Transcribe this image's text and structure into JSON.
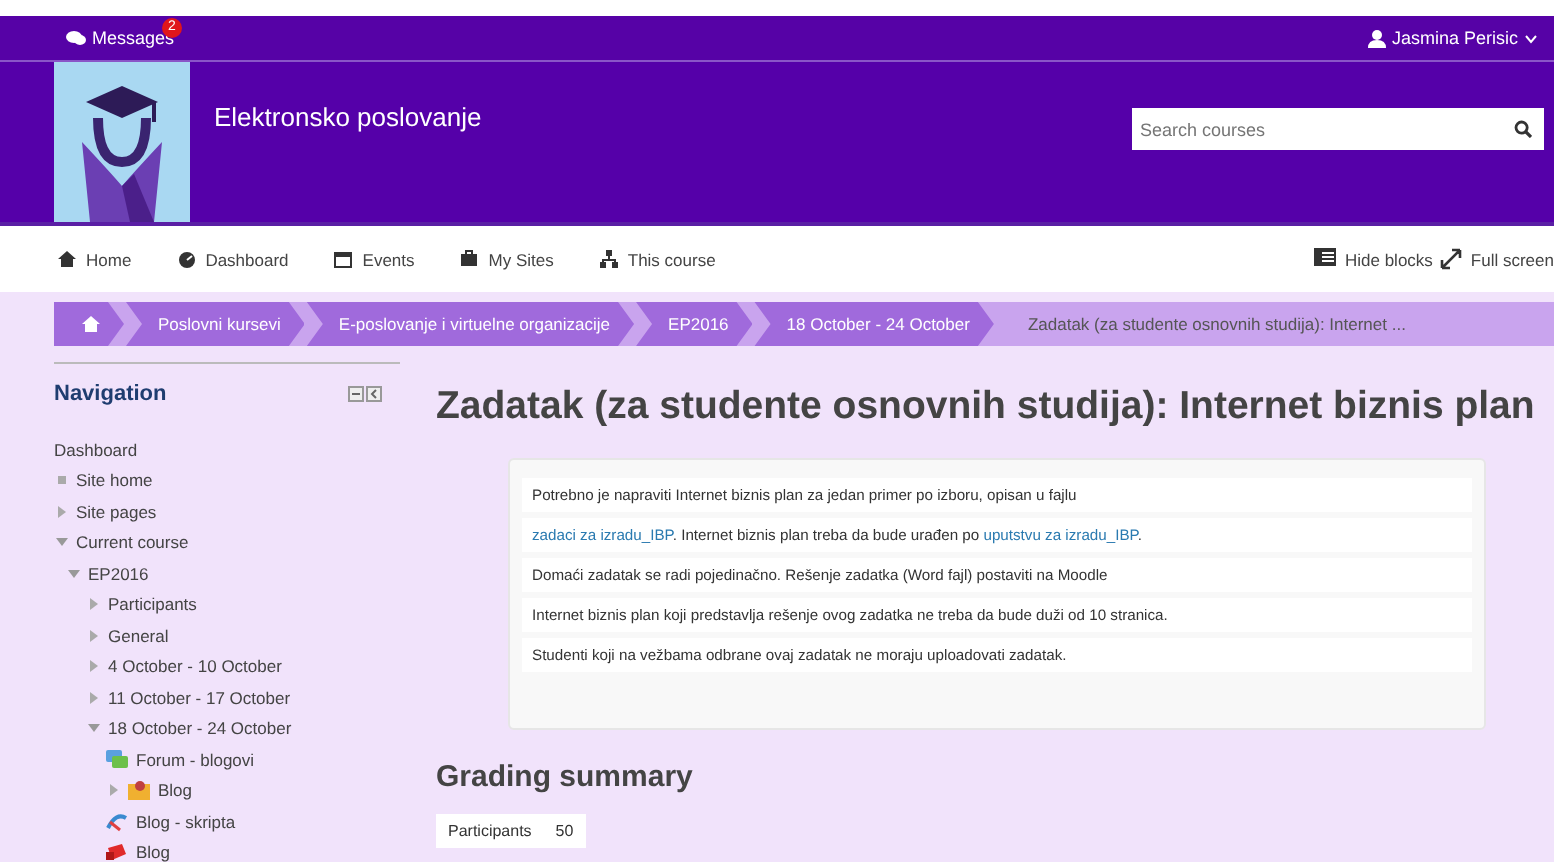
{
  "topbar": {
    "messages": {
      "label": "Messages",
      "badge": "2"
    },
    "user": "Jasmina Perisic"
  },
  "header": {
    "course_title": "Elektronsko poslovanje",
    "search": {
      "placeholder": "Search courses"
    }
  },
  "navbar": {
    "items": [
      "Home",
      "Dashboard",
      "Events",
      "My Sites",
      "This course"
    ],
    "actions": [
      "Hide blocks",
      "Full screen"
    ]
  },
  "breadcrumb": [
    {
      "kind": "home",
      "current": false
    },
    {
      "kind": "text",
      "label": "Poslovni kursevi",
      "current": false
    },
    {
      "kind": "text",
      "label": "E-poslovanje i virtuelne organizacije",
      "current": false
    },
    {
      "kind": "text",
      "label": "EP2016",
      "current": false
    },
    {
      "kind": "text",
      "label": "18 October - 24 October",
      "current": false
    },
    {
      "kind": "text",
      "label": "Zadatak (za studente osnovnih studija): Internet ...",
      "current": true
    }
  ],
  "navigation": {
    "title": "Navigation",
    "items": [
      {
        "label": "Dashboard",
        "kind": "plain"
      },
      {
        "label": "Site home",
        "kind": "bullet"
      },
      {
        "label": "Site pages",
        "kind": "branch",
        "expanded": false
      },
      {
        "label": "Current course",
        "kind": "branch",
        "expanded": true,
        "children": [
          {
            "label": "EP2016",
            "kind": "branch",
            "expanded": true,
            "children": [
              {
                "label": "Participants",
                "kind": "branch",
                "expanded": false
              },
              {
                "label": "General",
                "kind": "branch",
                "expanded": false
              },
              {
                "label": "4 October - 10 October",
                "kind": "branch",
                "expanded": false
              },
              {
                "label": "11 October - 17 October",
                "kind": "branch",
                "expanded": false
              },
              {
                "label": "18 October - 24 October",
                "kind": "branch",
                "expanded": true,
                "children": [
                  {
                    "label": "Forum - blogovi",
                    "kind": "forum"
                  },
                  {
                    "label": "Blog",
                    "kind": "folder",
                    "expanded": false
                  },
                  {
                    "label": "Blog - skripta",
                    "kind": "link"
                  },
                  {
                    "label": "Blog",
                    "kind": "blog"
                  }
                ]
              }
            ]
          }
        ]
      }
    ]
  },
  "main": {
    "title": "Zadatak (za studente osnovnih studija): Internet biznis plan",
    "paragraphs": [
      [
        {
          "kind": "text",
          "text": "Potrebno je napraviti Internet biznis plan za jedan primer po izboru, opisan u fajlu"
        }
      ],
      [
        {
          "kind": "link",
          "text": "zadaci za izradu_IBP"
        },
        {
          "kind": "text",
          "text": ". Internet biznis plan treba da bude urađen po "
        },
        {
          "kind": "link",
          "text": "uputstvu za izradu_IBP"
        },
        {
          "kind": "text",
          "text": "."
        }
      ],
      [
        {
          "kind": "text",
          "text": "Domaći zadatak se radi pojedinačno. Rešenje zadatka (Word fajl) postaviti na Moodle"
        }
      ],
      [
        {
          "kind": "text",
          "text": "Internet biznis plan koji predstavlja rešenje ovog zadatka ne treba da bude duži od 10 stranica."
        }
      ],
      [
        {
          "kind": "text",
          "text": "Studenti koji na vežbama odbrane ovaj zadatak ne moraju uploadovati zadatak."
        }
      ]
    ],
    "grading": {
      "title": "Grading summary",
      "rows": [
        {
          "label": "Participants",
          "value": "50"
        }
      ]
    }
  }
}
